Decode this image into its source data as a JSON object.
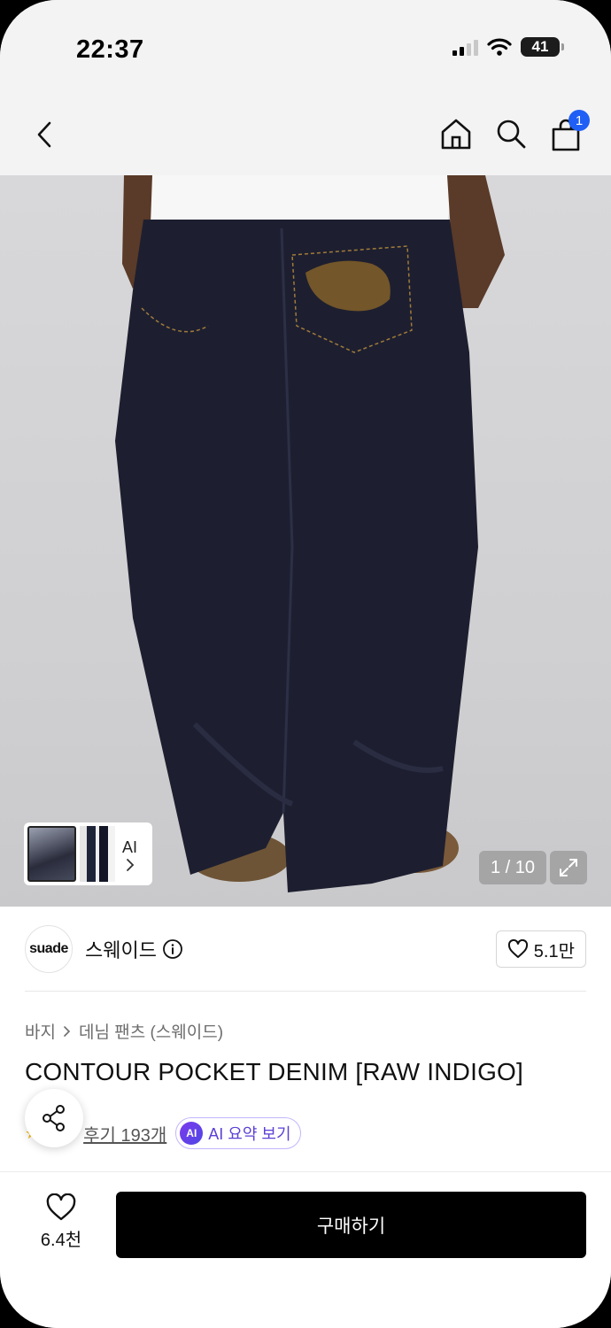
{
  "status_bar": {
    "time": "22:37",
    "battery": "41"
  },
  "header": {
    "cart_count": "1"
  },
  "gallery": {
    "counter": "1 / 10",
    "ai_label": "AI"
  },
  "brand": {
    "logo_text": "suade",
    "name": "스웨이드",
    "likes": "5.1만"
  },
  "breadcrumb": {
    "level1": "바지",
    "level2": "데님 팬츠 (스웨이드)"
  },
  "product": {
    "title": "CONTOUR POCKET DENIM [RAW INDIGO]"
  },
  "reviews": {
    "stars": "★",
    "label": "후기 193개",
    "ai_badge": "AI",
    "ai_summary": "AI 요약 보기"
  },
  "bottom_bar": {
    "wish_count": "6.4천",
    "buy_label": "구매하기"
  },
  "colors": {
    "accent_badge": "#1f5ff5",
    "ai_purple": "#5b3fd6",
    "buy_button": "#000000"
  }
}
